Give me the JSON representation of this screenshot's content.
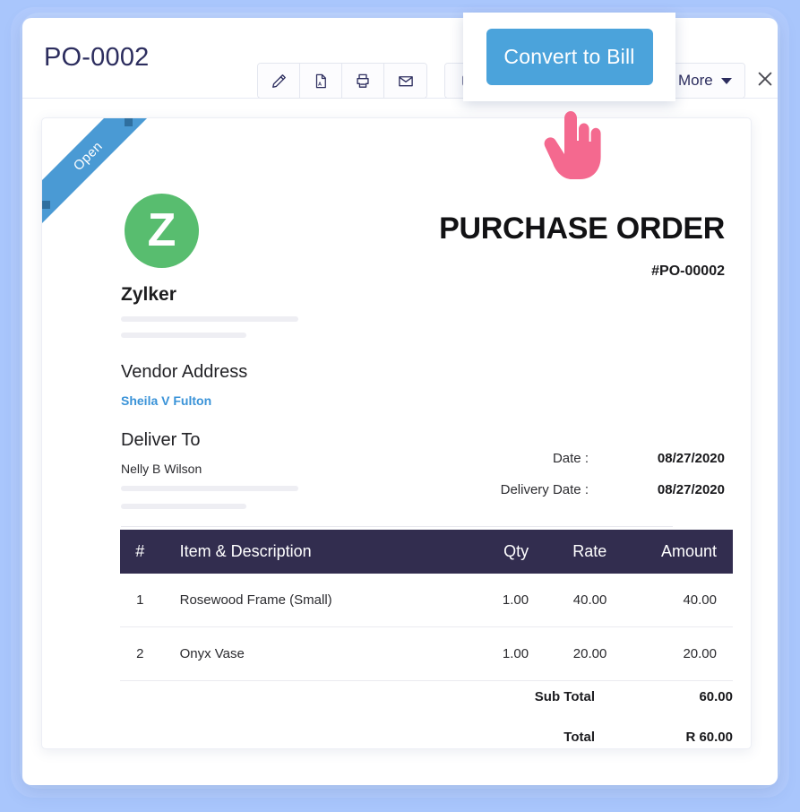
{
  "colors": {
    "page_background": "#a9c6fc",
    "accent_blue": "#4ba3db",
    "logo_green": "#58bd6f",
    "table_header": "#322d4f",
    "title_navy": "#2c2d5e",
    "link_blue": "#3a93d8",
    "cursor_pink": "#f4698f"
  },
  "header": {
    "title": "PO-0002",
    "toolbar": {
      "edit_label": "edit-pencil",
      "pdf_label": "pdf-file",
      "print_label": "print",
      "email_label": "email",
      "attach_label": "attachment"
    },
    "more_button": {
      "label": "More",
      "chevron": "chevron-down"
    },
    "close_label": "Close"
  },
  "popup": {
    "button_label": "Convert to Bill"
  },
  "cursor": {
    "type": "pointing-hand"
  },
  "document": {
    "status_ribbon": "Open",
    "logo_letter": "Z",
    "company_name": "Zylker",
    "title": "PURCHASE ORDER",
    "number": "#PO-00002",
    "vendor": {
      "heading": "Vendor Address",
      "name": "Sheila V Fulton"
    },
    "deliver": {
      "heading": "Deliver To",
      "name": "Nelly B Wilson"
    },
    "dates": [
      {
        "label": "Date :",
        "value": "08/27/2020"
      },
      {
        "label": "Delivery Date :",
        "value": "08/27/2020"
      }
    ],
    "table": {
      "columns": [
        "#",
        "Item & Description",
        "Qty",
        "Rate",
        "Amount"
      ],
      "rows": [
        {
          "num": "1",
          "desc": "Rosewood Frame (Small)",
          "qty": "1.00",
          "rate": "40.00",
          "amount": "40.00"
        },
        {
          "num": "2",
          "desc": "Onyx Vase",
          "qty": "1.00",
          "rate": "20.00",
          "amount": "20.00"
        }
      ]
    },
    "totals": [
      {
        "label": "Sub Total",
        "value": "60.00"
      },
      {
        "label": "Total",
        "value": "R 60.00"
      }
    ]
  }
}
